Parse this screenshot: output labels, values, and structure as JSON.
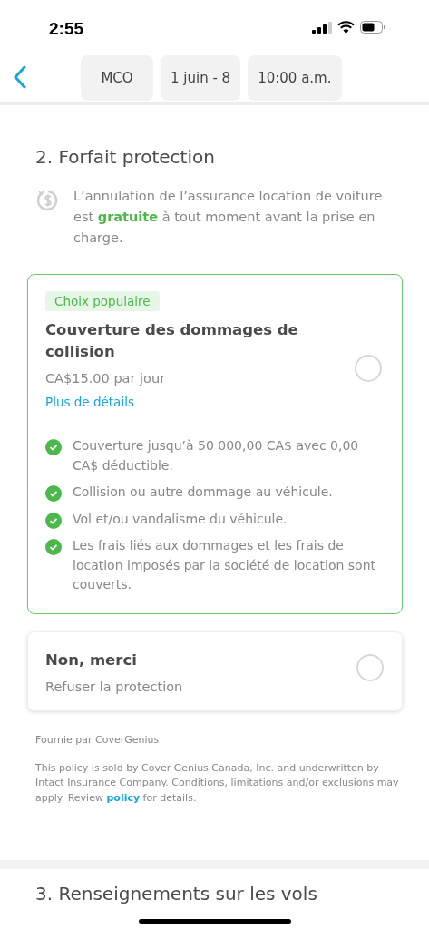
{
  "status_bar": {
    "time": "2:55"
  },
  "nav": {
    "chips": [
      "MCO",
      "1 juin - 8",
      "10:00 a.m."
    ]
  },
  "section": {
    "title": "2. Forfait protection",
    "notice": "L’annulation de l’assurance location de voiture est **gratuite** à tout moment avant la prise en charge."
  },
  "options": [
    {
      "kind": "plan",
      "badge": "Choix populaire",
      "title": "Couverture des dommages de collision",
      "price": "CA$15.00 par jour",
      "link": "Plus de détails",
      "selected": false,
      "features": [
        "Couverture jusqu’à 50 000,00 CA$ avec 0,00 CA$ déductible.",
        "Collision ou autre dommage au véhicule.",
        "Vol et/ou vandalisme du véhicule.",
        "Les frais liés aux dommages et les frais de location imposés par la société de location sont couverts."
      ]
    },
    {
      "kind": "decline",
      "title": "Non, merci",
      "subtitle": "Refuser la protection",
      "selected": false
    }
  ],
  "footer": {
    "provider": "Fournie par CoverGenius",
    "legal_before": "This policy is sold by Cover Genius Canada, Inc. and underwritten by Intact Insurance Company. Conditions, limitations and/or exclusions may apply. Review",
    "legal_link": "policy",
    "legal_after": "for details."
  },
  "next_section": {
    "title": "3. Renseignements sur les vols"
  }
}
